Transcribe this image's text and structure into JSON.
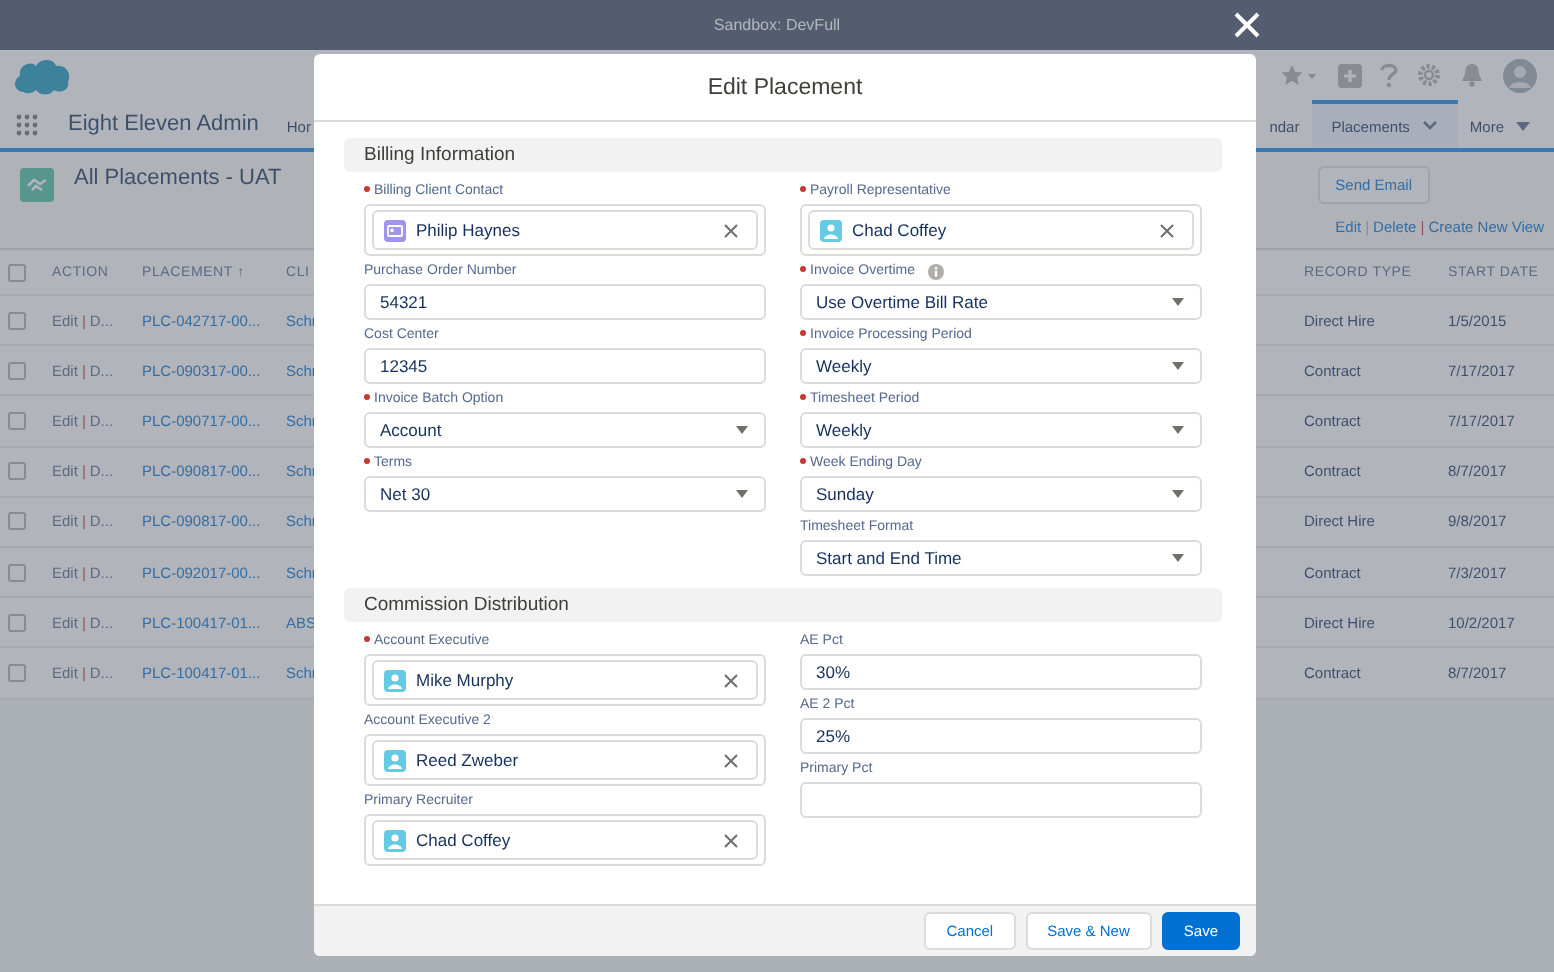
{
  "banner": {
    "text": "Sandbox: DevFull"
  },
  "nav": {
    "app_name": "Eight Eleven Admin",
    "items_left": [
      {
        "label": "Hor",
        "selected": false
      }
    ],
    "items_right": [
      {
        "label": "ndar",
        "selected": false,
        "kind": "tab"
      },
      {
        "label": "Placements",
        "selected": true,
        "kind": "dropdown_tab"
      },
      {
        "label": "More",
        "selected": false,
        "kind": "overflow_menu"
      }
    ]
  },
  "list_view": {
    "title": "All Placements - UAT",
    "send_email": "Send Email",
    "links": [
      "Edit",
      "Delete",
      "Create New View"
    ],
    "separators": [
      "|",
      "|"
    ]
  },
  "table": {
    "select_all_checked": false,
    "columns": [
      "ACTION",
      "PLACEMENT ↑",
      "CLI",
      "RECORD TYPE",
      "START DATE"
    ],
    "rows": [
      {
        "checked": false,
        "edit": "Edit",
        "separator": "|",
        "more": "D...",
        "placement": "PLC-042717-00...",
        "client": "Schr",
        "record_type": "Direct Hire",
        "start_date": "1/5/2015"
      },
      {
        "checked": false,
        "edit": "Edit",
        "separator": "|",
        "more": "D...",
        "placement": "PLC-090317-00...",
        "client": "Schr",
        "record_type": "Contract",
        "start_date": "7/17/2017"
      },
      {
        "checked": false,
        "edit": "Edit",
        "separator": "|",
        "more": "D...",
        "placement": "PLC-090717-00...",
        "client": "Schr",
        "record_type": "Contract",
        "start_date": "7/17/2017"
      },
      {
        "checked": false,
        "edit": "Edit",
        "separator": "|",
        "more": "D...",
        "placement": "PLC-090817-00...",
        "client": "Schr",
        "record_type": "Contract",
        "start_date": "8/7/2017"
      },
      {
        "checked": false,
        "edit": "Edit",
        "separator": "|",
        "more": "D...",
        "placement": "PLC-090817-00...",
        "client": "Schr",
        "record_type": "Direct Hire",
        "start_date": "9/8/2017"
      },
      {
        "checked": false,
        "edit": "Edit",
        "separator": "|",
        "more": "D...",
        "placement": "PLC-092017-00...",
        "client": "Schr",
        "record_type": "Contract",
        "start_date": "7/3/2017"
      },
      {
        "checked": false,
        "edit": "Edit",
        "separator": "|",
        "more": "D...",
        "placement": "PLC-100417-01...",
        "client": "ABS",
        "record_type": "Direct Hire",
        "start_date": "10/2/2017"
      },
      {
        "checked": false,
        "edit": "Edit",
        "separator": "|",
        "more": "D...",
        "placement": "PLC-100417-01...",
        "client": "Schr",
        "record_type": "Contract",
        "start_date": "8/7/2017"
      }
    ]
  },
  "modal": {
    "title": "Edit Placement",
    "sections": [
      {
        "title": "Billing Information",
        "columns": [
          [
            {
              "kind": "contact_lookup",
              "label": "Billing Client Contact",
              "required": true,
              "value": "Philip Haynes"
            },
            {
              "kind": "text",
              "label": "Purchase Order Number",
              "required": false,
              "value": "54321"
            },
            {
              "kind": "text",
              "label": "Cost Center",
              "required": false,
              "value": "12345"
            },
            {
              "kind": "select",
              "label": "Invoice Batch Option",
              "required": true,
              "value": "Account"
            },
            {
              "kind": "select",
              "label": "Terms",
              "required": true,
              "value": "Net 30"
            }
          ],
          [
            {
              "kind": "user_lookup",
              "label": "Payroll Representative",
              "required": true,
              "value": "Chad Coffey"
            },
            {
              "kind": "select",
              "label": "Invoice Overtime",
              "required": true,
              "info": true,
              "value": "Use Overtime Bill Rate"
            },
            {
              "kind": "select",
              "label": "Invoice Processing Period",
              "required": true,
              "value": "Weekly"
            },
            {
              "kind": "select",
              "label": "Timesheet Period",
              "required": true,
              "value": "Weekly"
            },
            {
              "kind": "select",
              "label": "Week Ending Day",
              "required": true,
              "value": "Sunday"
            },
            {
              "kind": "select",
              "label": "Timesheet Format",
              "required": false,
              "value": "Start and End Time"
            }
          ]
        ]
      },
      {
        "title": "Commission Distribution",
        "columns": [
          [
            {
              "kind": "user_lookup",
              "label": "Account Executive",
              "required": true,
              "value": "Mike Murphy"
            },
            {
              "kind": "user_lookup",
              "label": "Account Executive 2",
              "required": false,
              "value": "Reed Zweber"
            },
            {
              "kind": "user_lookup",
              "label": "Primary Recruiter",
              "required": false,
              "value": "Chad Coffey"
            }
          ],
          [
            {
              "kind": "text",
              "label": "AE Pct",
              "required": false,
              "value": "30%"
            },
            {
              "kind": "text",
              "label": "AE 2 Pct",
              "required": false,
              "value": "25%"
            },
            {
              "kind": "text",
              "label": "Primary Pct",
              "required": false
            }
          ]
        ]
      }
    ],
    "buttons": [
      {
        "label": "Cancel",
        "kind": "neutral"
      },
      {
        "label": "Save & New",
        "kind": "neutral"
      },
      {
        "label": "Save",
        "kind": "brand"
      }
    ]
  }
}
